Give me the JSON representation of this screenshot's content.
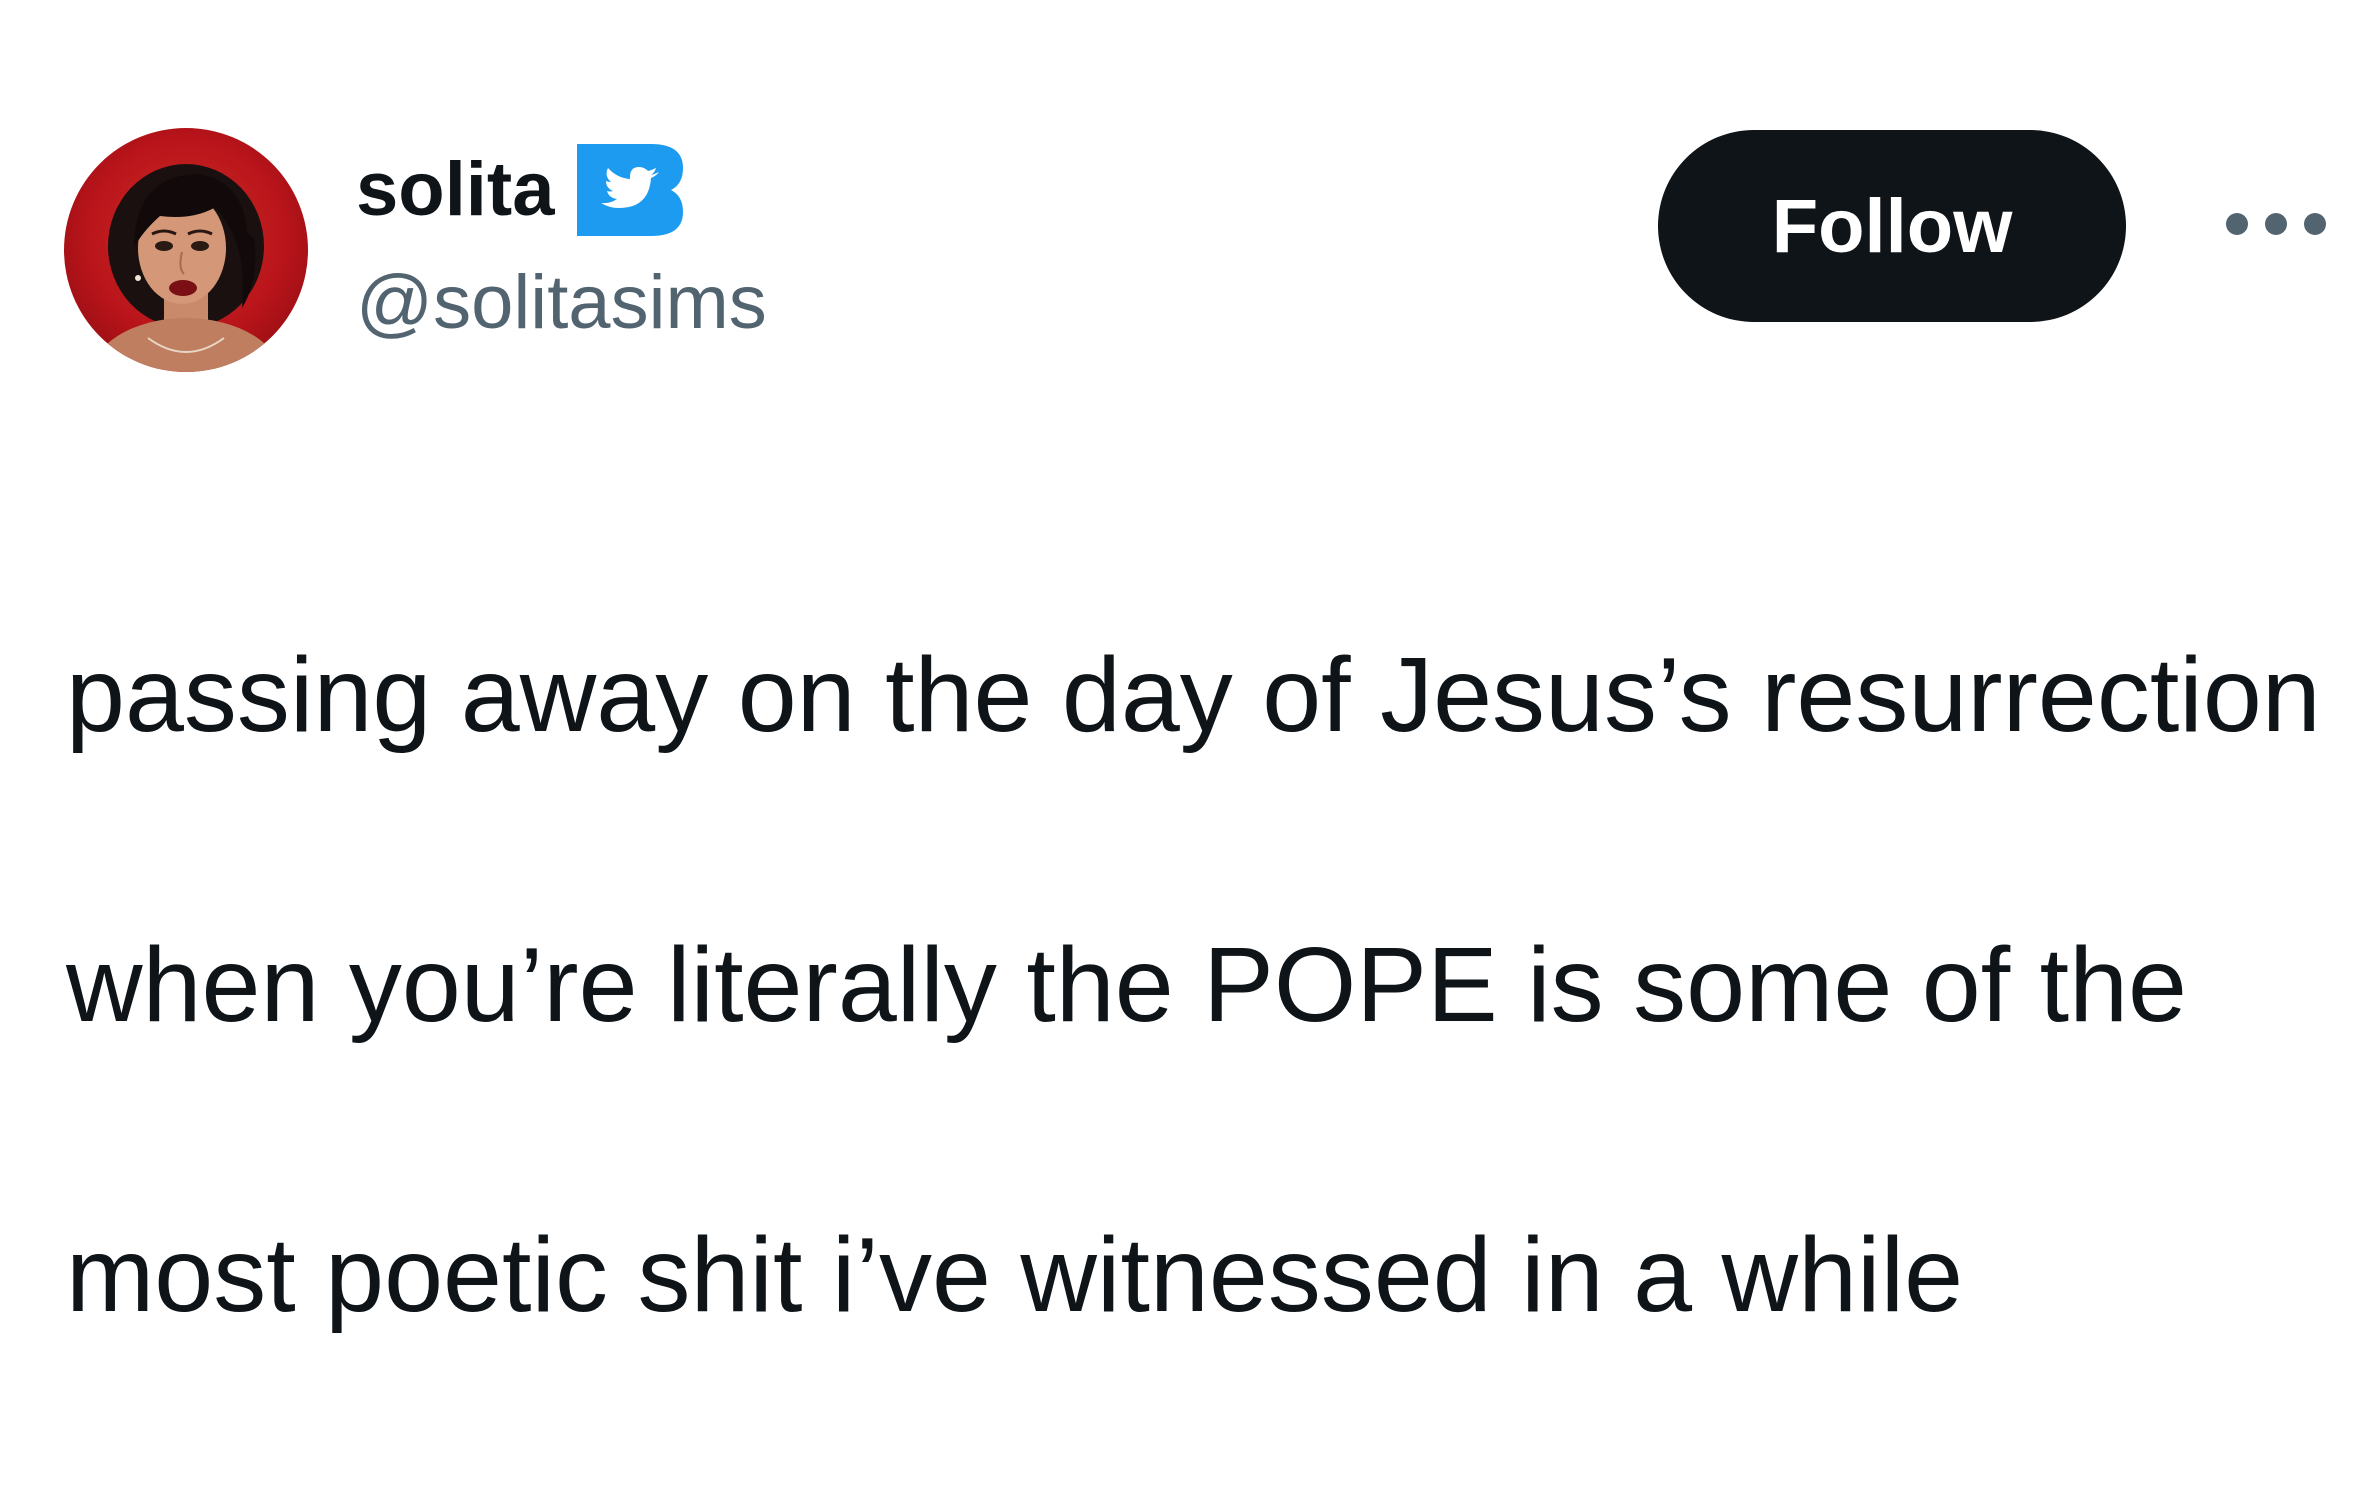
{
  "author": {
    "display_name": "solita",
    "handle": "@solitasims",
    "avatar_icon": "avatar-image",
    "verified_icon": "verified-badge-icon"
  },
  "actions": {
    "follow_label": "Follow",
    "more_icon": "more-options-icon"
  },
  "tweet": {
    "lines": [
      "passing away on the day of Jesus’s resurrection",
      "when you’re literally the POPE is some of the",
      "most poetic shit i’ve witnessed in a while"
    ]
  },
  "colors": {
    "text_primary": "#0f1419",
    "text_secondary": "#536471",
    "follow_bg": "#0f1419",
    "follow_text": "#ffffff",
    "verified_blue": "#1d9bf0",
    "background": "#ffffff"
  }
}
